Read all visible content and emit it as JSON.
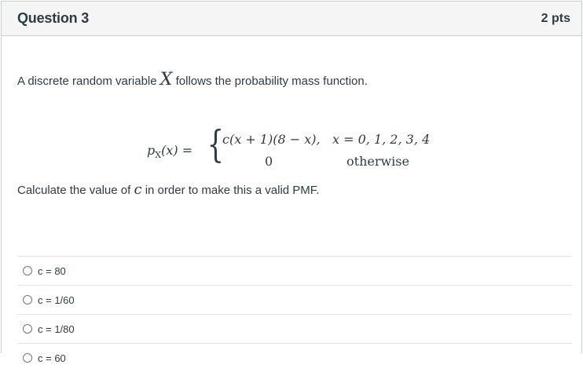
{
  "header": {
    "title": "Question 3",
    "points": "2 pts"
  },
  "question": {
    "intro_before": "A discrete random variable ",
    "intro_var": "X",
    "intro_after": " follows the probability mass function.",
    "formula": {
      "lhs": "p",
      "lhs_sub": "X",
      "lhs_arg": "(x) =",
      "case1_expr": "c(x + 1)(8 − x),",
      "case1_cond": "x = 0, 1, 2, 3, 4",
      "case2_expr": "0",
      "case2_cond": "otherwise"
    },
    "prompt_before": "Calculate the value of ",
    "prompt_var": "c",
    "prompt_after": " in order to make this a valid PMF."
  },
  "answers": [
    {
      "label": "c = 80"
    },
    {
      "label": "c = 1/60"
    },
    {
      "label": "c = 1/80"
    },
    {
      "label": "c = 60"
    }
  ]
}
